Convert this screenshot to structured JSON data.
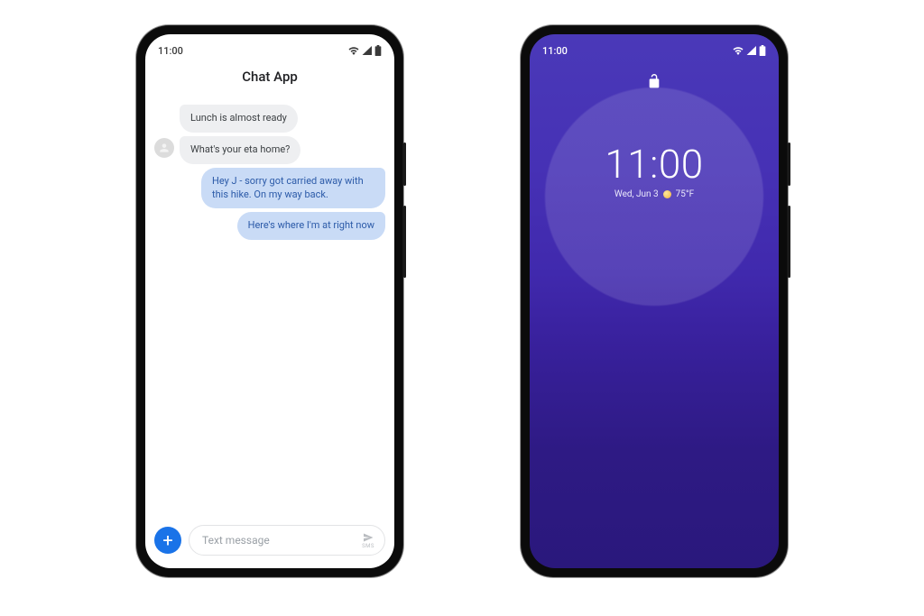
{
  "left": {
    "status_time": "11:00",
    "app_title": "Chat App",
    "messages": [
      {
        "dir": "in",
        "show_avatar": false,
        "text": "Lunch is almost ready"
      },
      {
        "dir": "in",
        "show_avatar": true,
        "text": "What's your eta home?"
      },
      {
        "dir": "out",
        "show_avatar": false,
        "text": "Hey J - sorry got carried away with this hike. On my way back."
      },
      {
        "dir": "out",
        "show_avatar": false,
        "text": "Here's where I'm at right now"
      }
    ],
    "composer": {
      "placeholder": "Text message",
      "send_mode": "SMS"
    }
  },
  "right": {
    "status_time": "11:00",
    "clock": "11:00",
    "date": "Wed, Jun 3",
    "temp": "75°F"
  }
}
